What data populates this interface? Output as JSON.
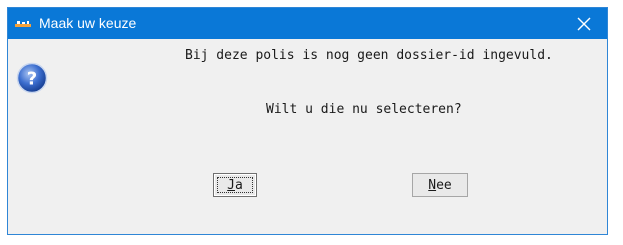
{
  "window": {
    "title": "Maak uw keuze"
  },
  "icons": {
    "app": "java-app-icon",
    "message": "question-icon",
    "close": "close-icon"
  },
  "message": {
    "line1": "Bij deze polis is nog geen dossier-id ingevuld.",
    "line2": "Wilt u die nu selecteren?"
  },
  "buttons": {
    "yes": {
      "mnemonic": "J",
      "rest": "a"
    },
    "no": {
      "mnemonic": "N",
      "rest": "ee"
    }
  },
  "colors": {
    "titlebar": "#0a78d7",
    "dialog_bg": "#f0f0f0",
    "border": "#2f86d6"
  }
}
